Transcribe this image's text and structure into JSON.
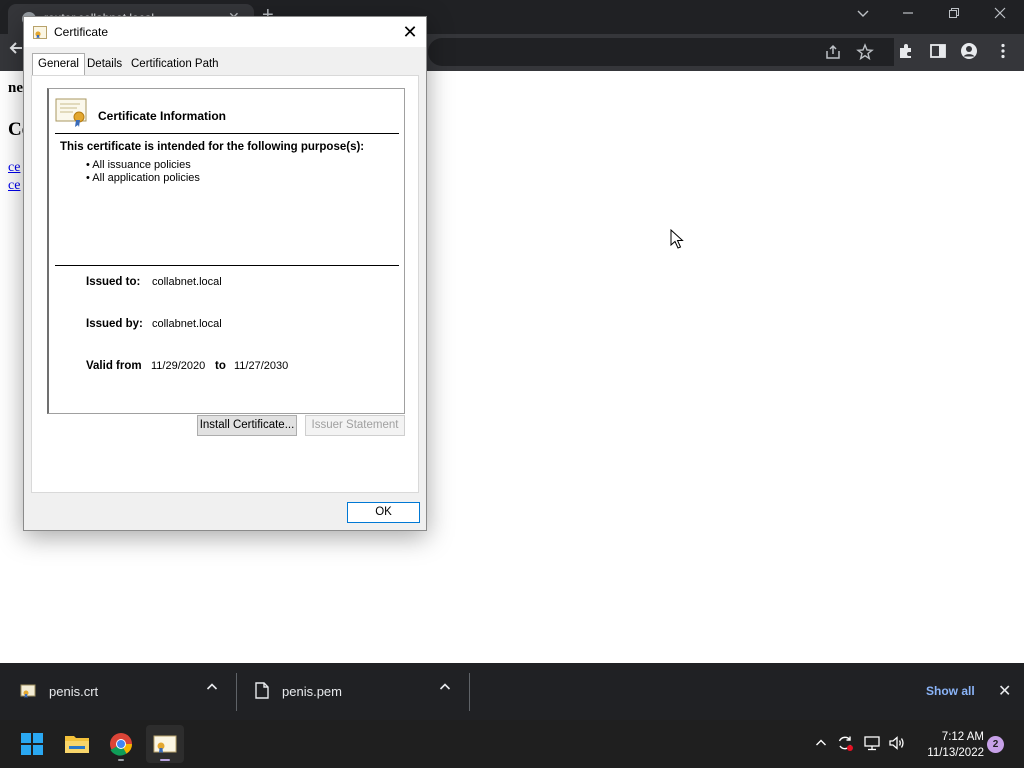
{
  "browser": {
    "tab_title": "router.collabnet.local",
    "tab_close": "✕",
    "new_tab": "+"
  },
  "page": {
    "fragment_1": "ne",
    "fragment_2": "Ce",
    "link_1": "ce",
    "link_2": "ce"
  },
  "dialog": {
    "title": "Certificate",
    "close_glyph": "✕",
    "tabs": [
      "General",
      "Details",
      "Certification Path"
    ],
    "heading": "Certificate Information",
    "purpose_intro": "This certificate is intended for the following purpose(s):",
    "purposes": [
      "• All issuance policies",
      "• All application policies"
    ],
    "issued_to_label": "Issued to:",
    "issued_to": "collabnet.local",
    "issued_by_label": "Issued by:",
    "issued_by": "collabnet.local",
    "valid_from_label": "Valid from",
    "valid_from": "11/29/2020",
    "to_label": "to",
    "valid_to": "11/27/2030",
    "install_button": "Install Certificate...",
    "issuer_statement_button": "Issuer Statement",
    "ok_button": "OK"
  },
  "downloads": {
    "items": [
      {
        "name": "penis.crt",
        "icon": "certificate-file-icon"
      },
      {
        "name": "penis.pem",
        "icon": "document-file-icon"
      }
    ],
    "show_all": "Show all",
    "close_glyph": "✕"
  },
  "taskbar": {
    "time": "7:12 AM",
    "date": "11/13/2022",
    "notification_count": "2"
  },
  "colors": {
    "browser_dark": "#202124",
    "toolbar": "#35363a",
    "dialog_bg": "#f0f0f0",
    "accent": "#0078d4",
    "link": "#8ab4f8"
  }
}
